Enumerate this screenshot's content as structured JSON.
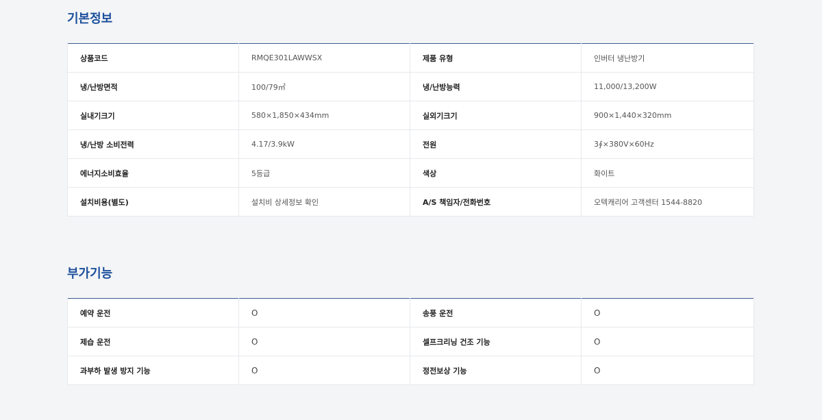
{
  "basic_info": {
    "title": "기본정보",
    "rows": [
      {
        "label1": "상품코드",
        "value1": "RMQE301LAWWSX",
        "label2": "제품 유형",
        "value2": "인버터 냉난방기"
      },
      {
        "label1": "냉/난방면적",
        "value1": "100/79㎡",
        "label2": "냉/난방능력",
        "value2": "11,000/13,200W"
      },
      {
        "label1": "실내기크기",
        "value1": "580×1,850×434mm",
        "label2": "실외기크기",
        "value2": "900×1,440×320mm"
      },
      {
        "label1": "냉/난방 소비전력",
        "value1": "4.17/3.9kW",
        "label2": "전원",
        "value2": "3∮×380V×60Hz"
      },
      {
        "label1": "에너지소비효율",
        "value1": "5등급",
        "label2": "색상",
        "value2": "화이트"
      },
      {
        "label1": "설치비용(별도)",
        "value1": "설치비 상세정보 확인",
        "label2": "A/S 책임자/전화번호",
        "value2": "오텍캐리어 고객센터 1544-8820"
      }
    ]
  },
  "additional_features": {
    "title": "부가기능",
    "rows": [
      {
        "label1": "예약 운전",
        "value1": "O",
        "label2": "송풍 운전",
        "value2": "O"
      },
      {
        "label1": "제습 운전",
        "value1": "O",
        "label2": "셀프크리닝 건조 기능",
        "value2": "O"
      },
      {
        "label1": "과부하 발생 방지 기능",
        "value1": "O",
        "label2": "정전보상 기능",
        "value2": "O"
      }
    ]
  }
}
